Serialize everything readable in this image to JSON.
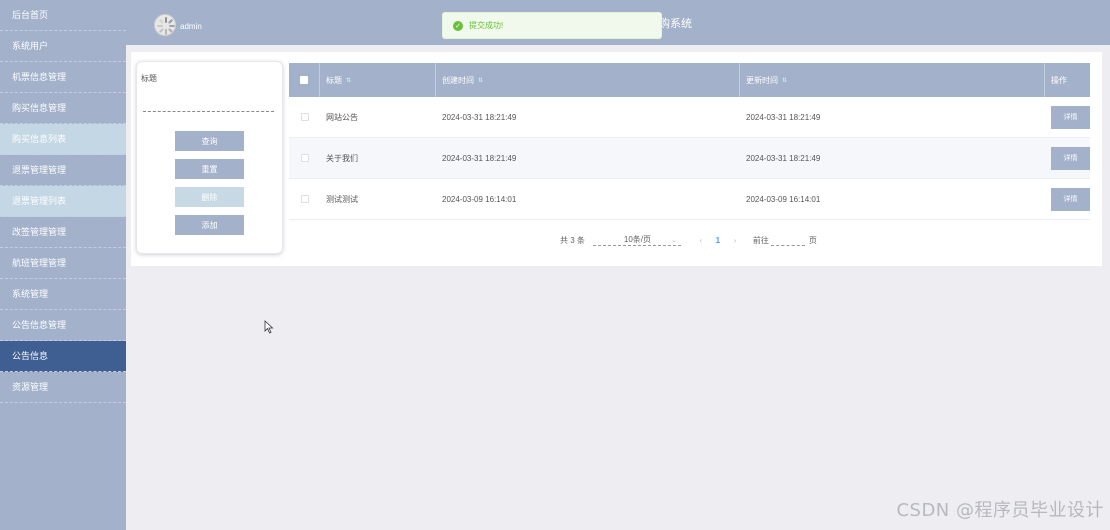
{
  "sidebar": {
    "items": [
      {
        "label": "后台首页",
        "type": "normal"
      },
      {
        "label": "系统用户",
        "type": "normal"
      },
      {
        "label": "机票信息管理",
        "type": "normal"
      },
      {
        "label": "购买信息管理",
        "type": "normal"
      },
      {
        "label": "购买信息列表",
        "type": "sub"
      },
      {
        "label": "退票管理管理",
        "type": "normal"
      },
      {
        "label": "退票管理列表",
        "type": "sub"
      },
      {
        "label": "改签管理管理",
        "type": "normal"
      },
      {
        "label": "航班管理管理",
        "type": "normal"
      },
      {
        "label": "系统管理",
        "type": "normal"
      },
      {
        "label": "公告信息管理",
        "type": "normal"
      },
      {
        "label": "公告信息",
        "type": "active"
      },
      {
        "label": "资源管理",
        "type": "normal"
      }
    ]
  },
  "header": {
    "username": "admin",
    "system_title": "购系统",
    "toast": "提交成功!"
  },
  "search": {
    "label": "标题",
    "buttons": {
      "query": "查询",
      "reset": "重置",
      "delete": "删除",
      "add": "添加"
    }
  },
  "table": {
    "columns": {
      "title": "标题",
      "created": "创建时间",
      "updated": "更新时间",
      "action": "操作"
    },
    "rows": [
      {
        "title": "网站公告",
        "created": "2024-03-31 18:21:49",
        "updated": "2024-03-31 18:21:49",
        "action": "详情"
      },
      {
        "title": "关于我们",
        "created": "2024-03-31 18:21:49",
        "updated": "2024-03-31 18:21:49",
        "action": "详情"
      },
      {
        "title": "测试测试",
        "created": "2024-03-09 16:14:01",
        "updated": "2024-03-09 16:14:01",
        "action": "详情"
      }
    ]
  },
  "pagination": {
    "total": "共 3 条",
    "page_size": "10条/页",
    "current": "1",
    "goto_prefix": "前往",
    "goto_suffix": "页"
  },
  "watermark": "CSDN @程序员毕业设计",
  "colors": {
    "sidebar": "#a3b1cb",
    "sidebar_sub": "#c4d7e4",
    "sidebar_active": "#3f5e92",
    "success": "#67c23a",
    "page_link": "#409eff"
  }
}
